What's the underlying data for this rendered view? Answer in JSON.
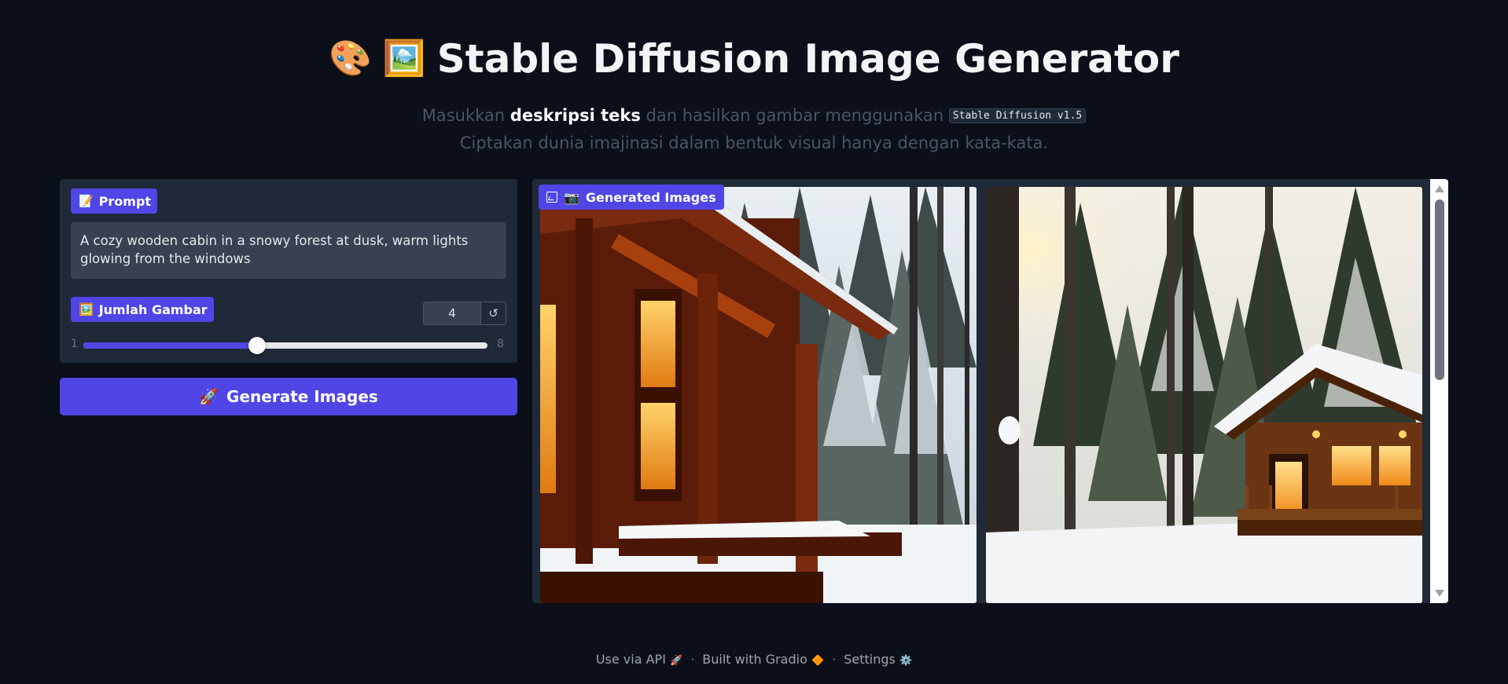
{
  "header": {
    "emoji_1": "🎨",
    "emoji_2": "🖼️",
    "title": "Stable Diffusion Image Generator",
    "sub_prefix": "Masukkan",
    "sub_bold": "deskripsi teks",
    "sub_middle": "dan hasilkan gambar menggunakan",
    "sub_code": "Stable Diffusion v1.5",
    "sub_line2": "Ciptakan dunia imajinasi dalam bentuk visual hanya dengan kata-kata."
  },
  "prompt": {
    "emoji": "📝",
    "label": "Prompt",
    "value": "A cozy wooden cabin in a snowy forest at dusk, warm lights glowing from the windows"
  },
  "count": {
    "emoji": "🖼️",
    "label": "Jumlah Gambar",
    "value": "4",
    "min": "1",
    "max": "8",
    "fraction": 0.43,
    "reset_glyph": "↺"
  },
  "generate": {
    "emoji": "🚀",
    "label": "Generate Images"
  },
  "gallery": {
    "emoji": "📷",
    "label": "Generated Images"
  },
  "footer": {
    "api": "Use via API",
    "api_emoji": "🚀",
    "sep": "·",
    "built": "Built with Gradio",
    "built_emoji": "🔶",
    "settings": "Settings",
    "settings_emoji": "⚙️"
  },
  "colors": {
    "background": "#0b0f19",
    "panel": "#1f2937",
    "accent": "#4f46e5"
  }
}
